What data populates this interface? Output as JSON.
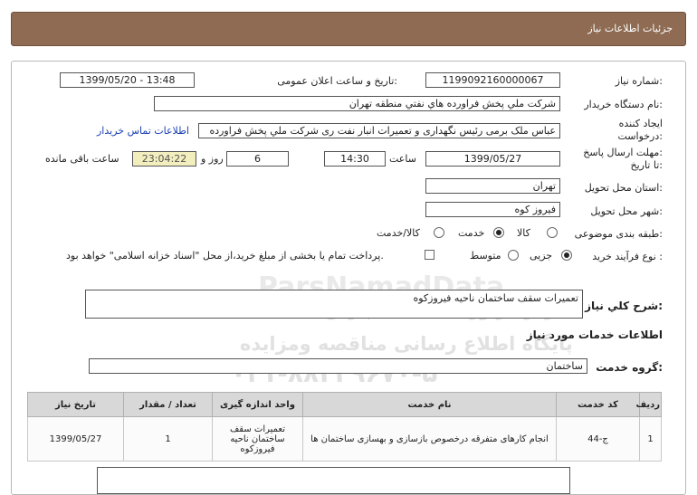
{
  "header": {
    "title": "جزئیات اطلاعات نیاز"
  },
  "fields": {
    "need_number_label": "شماره نیاز:",
    "need_number": "1199092160000067",
    "announce_label": "تاریخ و ساعت اعلان عمومی:",
    "announce_value": "1399/05/20 - 13:48",
    "buyer_label": "نام دستگاه خریدار:",
    "buyer_value": "شرکت ملي پخش فراورده هاي نفتي منطقه تهران",
    "creator_label_1": "ایجاد کننده",
    "creator_label_2": "درخواست:",
    "creator_value": "عباس ملک برمی رئیس نگهداری و تعمیرات انبار نفت ری شرکت ملي پخش فراورده",
    "contact_link": "اطلاعات تماس خریدار",
    "deadline_label_1": "مهلت ارسال پاسخ:",
    "deadline_label_2": "تا تاریخ:",
    "deadline_date": "1399/05/27",
    "time_label": "ساعت",
    "deadline_time": "14:30",
    "days_value": "6",
    "days_label": "روز و",
    "remaining_value": "23:04:22",
    "remaining_label": "ساعت باقی مانده",
    "province_label": "استان محل تحویل:",
    "province_value": "تهران",
    "city_label": "شهر محل تحویل:",
    "city_value": "فیروز کوه",
    "category_label": "طبقه بندی موضوعی:",
    "category_options": [
      "کالا",
      "خدمت",
      "کالا/خدمت"
    ],
    "category_selected": "خدمت",
    "process_label": "نوع فرآیند خرید :",
    "process_options": [
      "جزیی",
      "متوسط"
    ],
    "process_selected": "جزیی",
    "payment_text": "پرداخت تمام یا بخشی از مبلغ خرید،از محل \"اسناد خزانه اسلامی\" خواهد بود."
  },
  "summary": {
    "label": "شرح کلي نياز:",
    "value": "تعمیرات سقف ساختمان  ناحیه فیروزکوه"
  },
  "services": {
    "section_title": "اطلاعات خدمات مورد نیاز",
    "group_label": "گروه خدمت:",
    "group_value": "ساختمان",
    "columns": [
      "ردیف",
      "کد خدمت",
      "نام خدمت",
      "واحد اندازه گیری",
      "تعداد / مقدار",
      "تاریخ نیاز"
    ],
    "rows": [
      {
        "row": "1",
        "code": "ج-44",
        "name": "انجام کارهای متفرقه درخصوص بازسازی و بهسازی ساختمان ها",
        "unit": "تعمیرات سقف ساختمان ناحیه فیروزکوه",
        "qty": "1",
        "date": "1399/05/27"
      }
    ]
  },
  "watermark": {
    "line1": "ParsNamadData",
    "line2": "مرکز فراوری اطلاعات پارس نماد داده ها",
    "line3": "پایگاه اطلاع رسانی مناقصه ومزایده",
    "line4": "۰۲۱-۸۸۳۴۹۶۷۰-۵"
  },
  "colors": {
    "header_bg": "#8e6b52",
    "remaining_bg": "#f3eebd",
    "link": "#1a3fb4"
  }
}
